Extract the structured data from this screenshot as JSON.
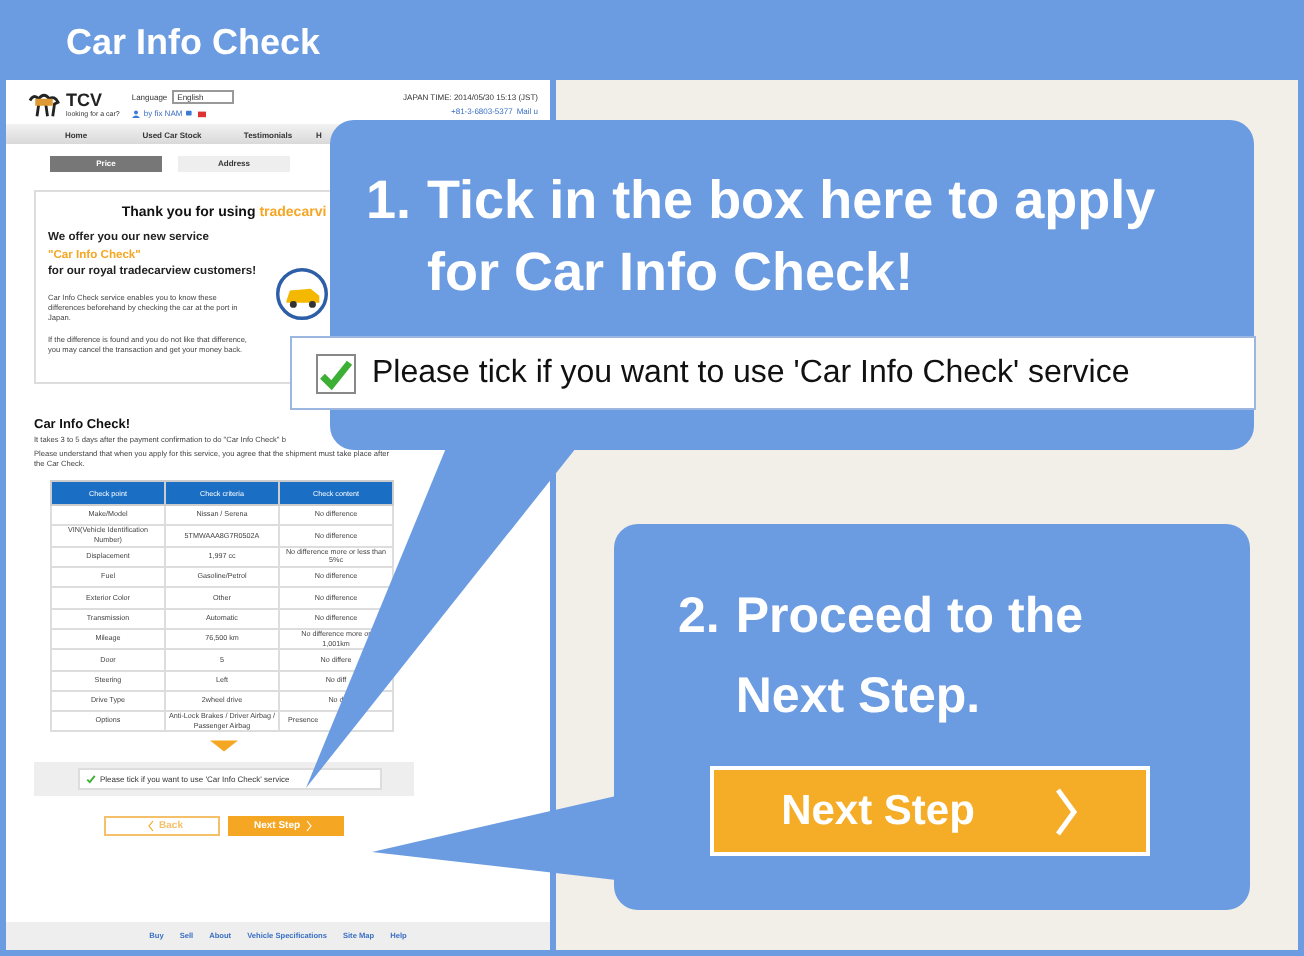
{
  "window": {
    "title": "Car Info Check"
  },
  "site": {
    "tagline": "looking for a car?",
    "brand": "TCV",
    "language_label": "Language",
    "language": "English",
    "user": "by fix NAM",
    "time": "JAPAN TIME: 2014/05/30 15:13 (JST)",
    "phone": "+81-3-6803-5377",
    "mail": "Mail u",
    "nav": [
      "Home",
      "Used Car Stock",
      "Testimonials",
      "H"
    ],
    "steps": [
      {
        "label": "Price",
        "selected": true
      },
      {
        "label": "Address",
        "selected": false
      }
    ],
    "promo": {
      "thanks": "Thank you for using",
      "thanks_brand": "tradecarvi",
      "offer": "We offer you our new service",
      "service": "\"Car Info Check\"",
      "audience": "for our royal tradecarview customers!",
      "paragraphs": [
        "Car Info Check service enables you to know these differences beforehand by checking the car at the port in Japan.",
        "If the difference is found and you do not like that difference, you may cancel the transaction and get your money back."
      ]
    },
    "section": {
      "heading": "Car Info Check!",
      "line_1": "It takes 3 to 5 days after the payment confirmation to do \"Car Info Check\" b",
      "line_2": "Please understand that when you apply for this service, you agree that the shipment must take place after the Car Check."
    },
    "table": {
      "columns": [
        "Check point",
        "Check criteria",
        "Check content"
      ],
      "rows": [
        [
          "Make/Model",
          "Nissan / Serena",
          "No difference"
        ],
        [
          "VIN(Vehicle Identification Number)",
          "5TMWAAA8G7R0502A",
          "No difference"
        ],
        [
          "Displacement",
          "1,997 cc",
          "No difference more or less than 5%c"
        ],
        [
          "Fuel",
          "Gasoline/Petrol",
          "No difference"
        ],
        [
          "Exterior Color",
          "Other",
          "No difference"
        ],
        [
          "Transmission",
          "Automatic",
          "No difference"
        ],
        [
          "Mileage",
          "76,500 km",
          "No difference more or\n1,001km"
        ],
        [
          "Door",
          "5",
          "No differe"
        ],
        [
          "Steering",
          "Left",
          "No diff"
        ],
        [
          "Drive Type",
          "2wheel drive",
          "No d"
        ],
        [
          "Options",
          "Anti-Lock Brakes / Driver Airbag / Passenger Airbag",
          "Presence"
        ]
      ]
    },
    "consent": {
      "checked": true,
      "label": "Please tick if you want to use 'Car Info Check' service"
    },
    "buttons": [
      {
        "label": "Back",
        "kind": "back"
      },
      {
        "label": "Next Step",
        "kind": "next"
      }
    ],
    "footer_links": [
      "Buy",
      "Sell",
      "About",
      "Vehicle Specifications",
      "Site Map",
      "Help"
    ]
  },
  "callouts": [
    {
      "number": "1.",
      "text": "Tick in the box here to apply for Car Info Check!",
      "checkbox": {
        "checked": true,
        "label": "Please tick if you want to use 'Car Info Check' service"
      }
    },
    {
      "number": "2.",
      "text": "Proceed to the Next Step.",
      "button": {
        "label": "Next Step"
      }
    }
  ]
}
